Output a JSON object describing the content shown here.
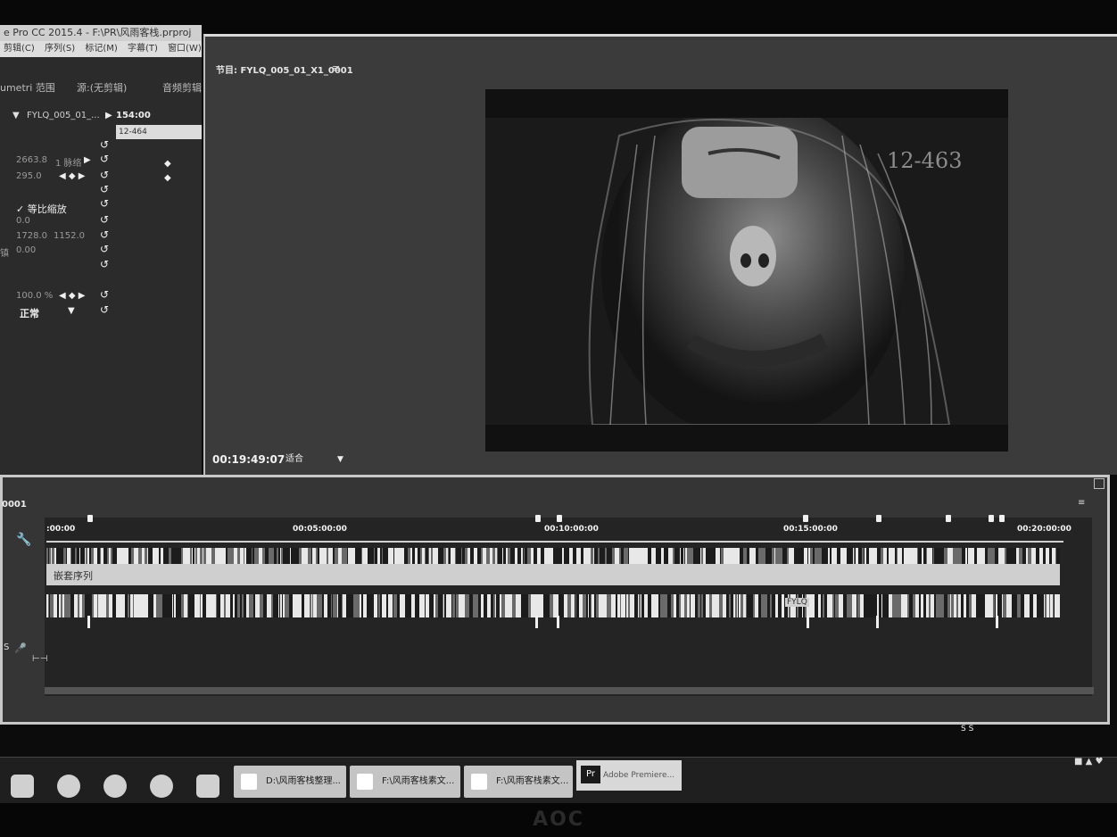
{
  "app": {
    "title": "e Pro CC 2015.4 - F:\\PR\\风雨客栈.prproj",
    "menu": [
      "剪辑(C)",
      "序列(S)",
      "标记(M)",
      "字幕(T)",
      "窗口(W)"
    ]
  },
  "effect_controls": {
    "tabs": [
      "umetri 范围",
      "源:(无剪辑)",
      "音频剪辑"
    ],
    "clip_name": "FYLQ_005_01_...",
    "mini_timecode": "154:00",
    "clip_chip": "12-464",
    "position_x": "2663.8",
    "position_y": "1 脉络",
    "scale": "295.0",
    "uniform_scale_label": "✓ 等比缩放",
    "rotation": "0.0",
    "anchor_x": "1728.0",
    "anchor_y": "1152.0",
    "flicker_label": "镇",
    "flicker_value": "0.00",
    "opacity": "100.0 %",
    "blend_mode": "正常"
  },
  "program_monitor": {
    "title": "节目: FYLQ_005_01_X1_0001",
    "menu_icon": "≡",
    "burned_timecode": "12-463",
    "timecode": "00:19:49:07",
    "fit_label": "适合",
    "fit_arrow": "▼"
  },
  "timeline": {
    "sequence_label": "0001",
    "menu_icon": "≡",
    "ruler_labels": [
      ":00:00",
      "00:05:00:00",
      "00:10:00:00",
      "00:15:00:00",
      "00:20:00:00"
    ],
    "nest_label": "嵌套序列",
    "clip_label": "FYLQ",
    "track_label": "S",
    "scroll_indicator": "S S"
  },
  "taskbar": {
    "buttons": [
      "D:\\风雨客栈整理...",
      "F:\\风雨客栈素文...",
      "F:\\风雨客栈素文..."
    ],
    "premiere_label": "Adobe Premiere...",
    "premiere_logo": "Pr",
    "tray": "■ ▲ ♥"
  },
  "monitor_brand": "AOC"
}
